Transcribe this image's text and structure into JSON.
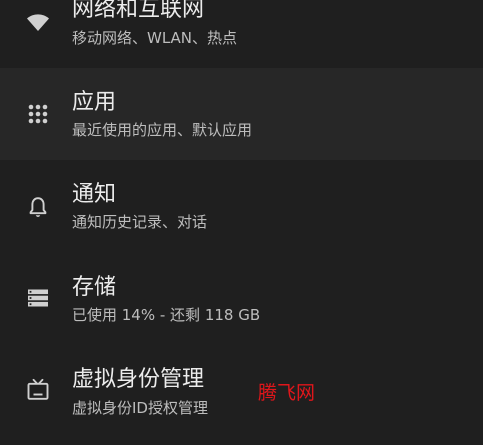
{
  "settings": {
    "items": [
      {
        "title": "网络和互联网",
        "subtitle": "移动网络、WLAN、热点",
        "icon": "wifi-icon"
      },
      {
        "title": "应用",
        "subtitle": "最近使用的应用、默认应用",
        "icon": "apps-grid-icon"
      },
      {
        "title": "通知",
        "subtitle": "通知历史记录、对话",
        "icon": "bell-icon"
      },
      {
        "title": "存储",
        "subtitle": "已使用 14% - 还剩 118 GB",
        "icon": "storage-icon"
      },
      {
        "title": "虚拟身份管理",
        "subtitle": "虚拟身份ID授权管理",
        "icon": "tv-icon"
      }
    ]
  },
  "watermark": {
    "text": "腾飞网"
  },
  "colors": {
    "background": "#1f1f1f",
    "highlight_row": "#272727",
    "title_text": "#ececec",
    "subtitle_text": "#bdbdbd",
    "icon": "#d0d0d0",
    "watermark": "#e0161b"
  }
}
